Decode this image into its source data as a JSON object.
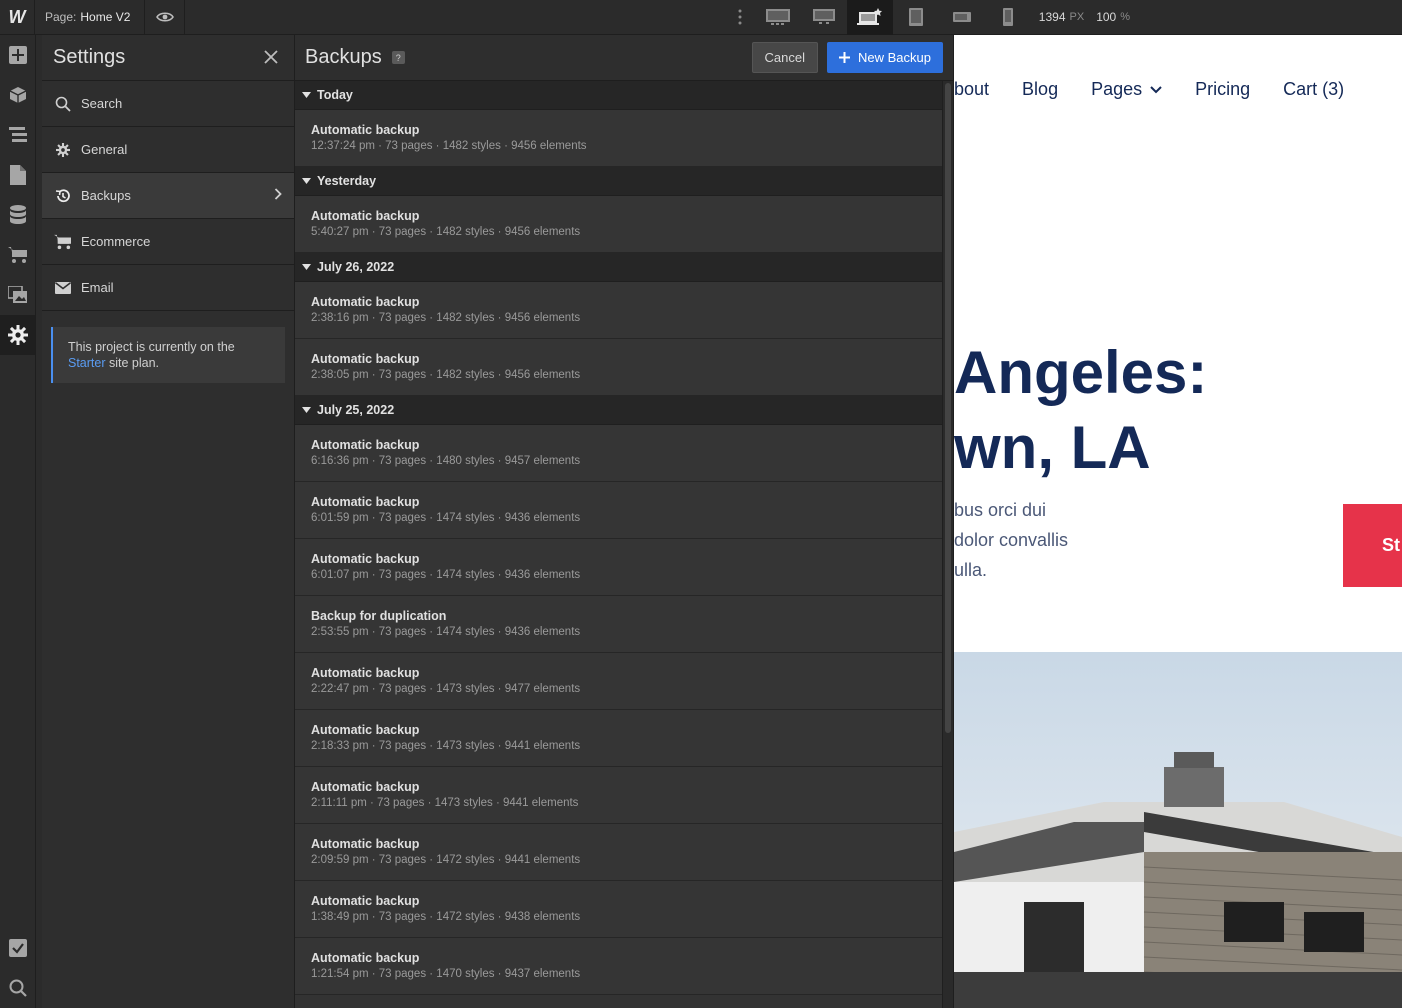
{
  "topbar": {
    "logo": "W",
    "page_label": "Page:",
    "page_value": "Home V2",
    "width_value": "1394",
    "width_unit": "PX",
    "zoom_value": "100",
    "zoom_unit": "%"
  },
  "settings": {
    "title": "Settings",
    "items": [
      {
        "label": "Search",
        "icon": "search-icon"
      },
      {
        "label": "General",
        "icon": "gear-icon"
      },
      {
        "label": "Backups",
        "icon": "history-icon"
      },
      {
        "label": "Ecommerce",
        "icon": "cart-icon"
      },
      {
        "label": "Email",
        "icon": "envelope-icon"
      }
    ],
    "plan_note_prefix": "This project is currently on the",
    "plan_link": "Starter",
    "plan_note_suffix": " site plan."
  },
  "backups": {
    "title": "Backups",
    "help": "?",
    "cancel_label": "Cancel",
    "new_label": "New Backup",
    "groups": [
      {
        "date": "Today",
        "rows": [
          {
            "name": "Automatic backup",
            "meta": "12:37:24 pm · 73 pages · 1482 styles · 9456 elements"
          }
        ]
      },
      {
        "date": "Yesterday",
        "rows": [
          {
            "name": "Automatic backup",
            "meta": "5:40:27 pm · 73 pages · 1482 styles · 9456 elements"
          }
        ]
      },
      {
        "date": "July 26, 2022",
        "rows": [
          {
            "name": "Automatic backup",
            "meta": "2:38:16 pm · 73 pages · 1482 styles · 9456 elements"
          },
          {
            "name": "Automatic backup",
            "meta": "2:38:05 pm · 73 pages · 1482 styles · 9456 elements"
          }
        ]
      },
      {
        "date": "July 25, 2022",
        "rows": [
          {
            "name": "Automatic backup",
            "meta": "6:16:36 pm · 73 pages · 1480 styles · 9457 elements"
          },
          {
            "name": "Automatic backup",
            "meta": "6:01:59 pm · 73 pages · 1474 styles · 9436 elements"
          },
          {
            "name": "Automatic backup",
            "meta": "6:01:07 pm · 73 pages · 1474 styles · 9436 elements"
          },
          {
            "name": "Backup for duplication",
            "meta": "2:53:55 pm · 73 pages · 1474 styles · 9436 elements"
          },
          {
            "name": "Automatic backup",
            "meta": "2:22:47 pm · 73 pages · 1473 styles · 9477 elements"
          },
          {
            "name": "Automatic backup",
            "meta": "2:18:33 pm · 73 pages · 1473 styles · 9441 elements"
          },
          {
            "name": "Automatic backup",
            "meta": "2:11:11 pm · 73 pages · 1473 styles · 9441 elements"
          },
          {
            "name": "Automatic backup",
            "meta": "2:09:59 pm · 73 pages · 1472 styles · 9441 elements"
          },
          {
            "name": "Automatic backup",
            "meta": "1:38:49 pm · 73 pages · 1472 styles · 9438 elements"
          },
          {
            "name": "Automatic backup",
            "meta": "1:21:54 pm · 73 pages · 1470 styles · 9437 elements"
          }
        ]
      }
    ]
  },
  "preview": {
    "nav": [
      "bout",
      "Blog",
      "Pages",
      "Pricing",
      "Cart (3)"
    ],
    "hero_line1": "Angeles:",
    "hero_line2": "wn, LA",
    "body_lines": [
      "bus orci dui",
      "dolor convallis",
      "ulla."
    ],
    "cta_label": "St"
  },
  "colors": {
    "accent_blue": "#2d6fdc",
    "brand_navy": "#142957",
    "cta_red": "#e6334a"
  }
}
